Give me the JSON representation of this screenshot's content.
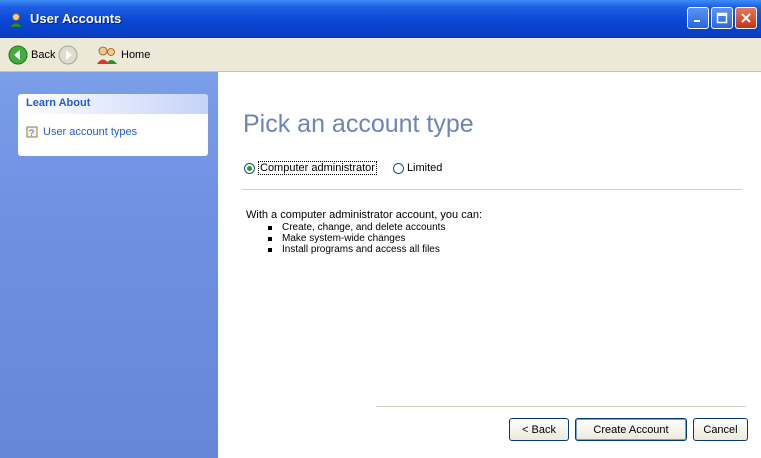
{
  "window": {
    "title": "User Accounts",
    "colors": {
      "titlebar": "#0a47d6",
      "sidebar": "#6f8fe0",
      "heading": "#6e84b8",
      "link": "#215dc6"
    }
  },
  "toolbar": {
    "back_label": "Back",
    "home_label": "Home"
  },
  "sidebar": {
    "learn_header": "Learn About",
    "items": [
      {
        "label": "User account types",
        "icon": "help-topic-icon"
      }
    ]
  },
  "main": {
    "heading": "Pick an account type",
    "radios": [
      {
        "label": "Computer administrator",
        "selected": true
      },
      {
        "label": "Limited",
        "selected": false
      }
    ],
    "description": "With a computer administrator account, you can:",
    "bullets": [
      "Create, change, and delete accounts",
      "Make system-wide changes",
      "Install programs and access all files"
    ]
  },
  "buttons": {
    "back": "< Back",
    "create": "Create Account",
    "cancel": "Cancel"
  }
}
